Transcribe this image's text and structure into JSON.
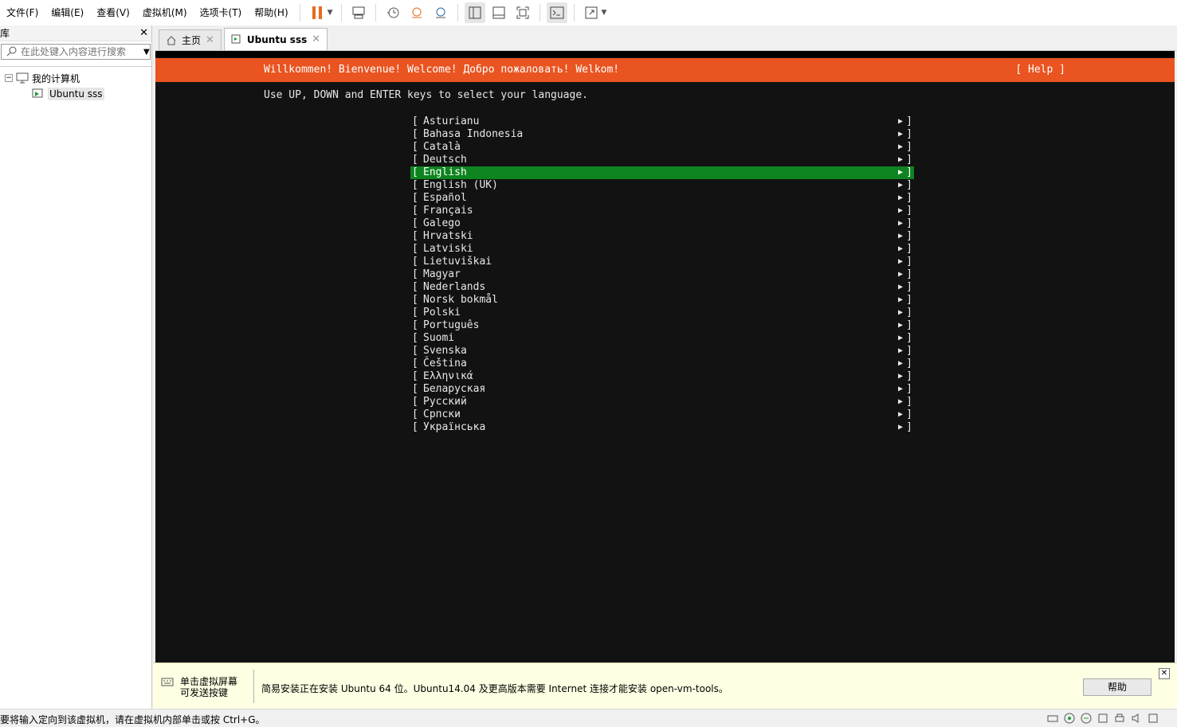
{
  "menu": [
    "文件(F)",
    "编辑(E)",
    "查看(V)",
    "虚拟机(M)",
    "选项卡(T)",
    "帮助(H)"
  ],
  "library": {
    "title": "库",
    "search_placeholder": "在此处键入内容进行搜索",
    "tree": {
      "root": "我的计算机",
      "vm": "Ubuntu sss"
    }
  },
  "tabs": [
    {
      "label": "主页",
      "icon": "home-icon"
    },
    {
      "label": "Ubuntu sss",
      "icon": "vm-icon"
    }
  ],
  "console": {
    "banner": "Willkommen! Bienvenue! Welcome! Добро пожаловать! Welkom!",
    "help": "[ Help ]",
    "instruction": "Use UP, DOWN and ENTER keys to select your language.",
    "selected_index": 4,
    "languages": [
      "Asturianu",
      "Bahasa Indonesia",
      "Català",
      "Deutsch",
      "English",
      "English (UK)",
      "Español",
      "Français",
      "Galego",
      "Hrvatski",
      "Latviski",
      "Lietuviškai",
      "Magyar",
      "Nederlands",
      "Norsk bokmål",
      "Polski",
      "Português",
      "Suomi",
      "Svenska",
      "Čeština",
      "Ελληνικά",
      "Беларуская",
      "Русский",
      "Српски",
      "Українська"
    ],
    "colors": {
      "banner": "#e95420",
      "selection": "#0e8420",
      "background": "#121212"
    }
  },
  "infobar": {
    "left_text": "单击虚拟屏幕\n可发送按键",
    "message": "简易安装正在安装 Ubuntu 64 位。Ubuntu14.04 及更高版本需要 Internet 连接才能安装 open-vm-tools。",
    "help_button": "帮助"
  },
  "statusbar": {
    "text": "要将输入定向到该虚拟机，请在虚拟机内部单击或按 Ctrl+G。"
  }
}
